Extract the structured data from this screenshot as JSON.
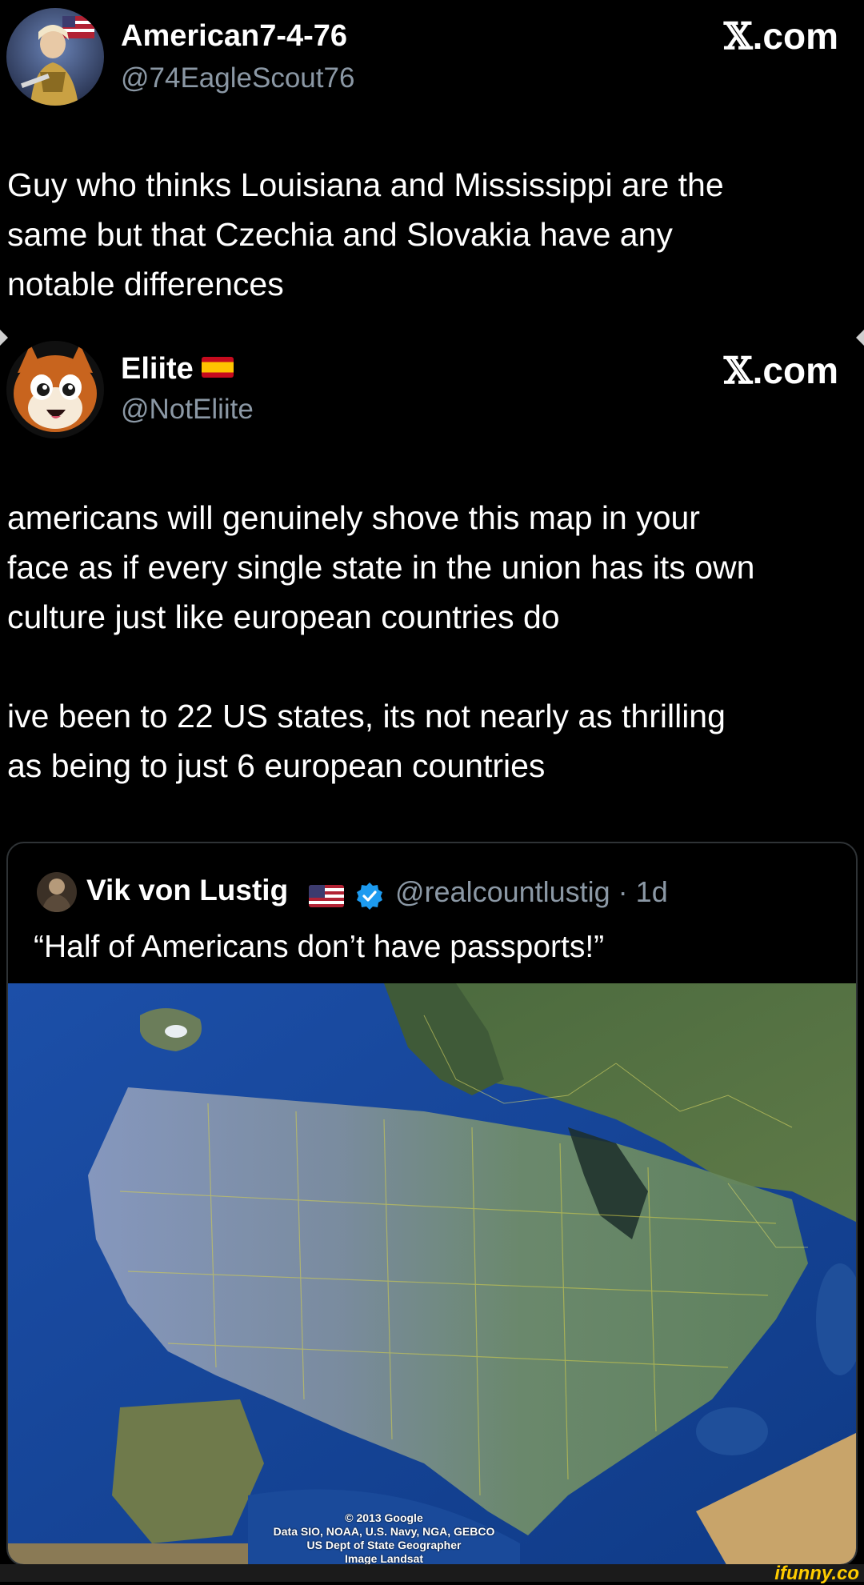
{
  "tweet1": {
    "display_name": "American7-4-76",
    "handle": "@74EagleScout76",
    "brand": ".com",
    "text": "Guy who thinks Louisiana and Mississippi are the\nsame but that Czechia and Slovakia have any\nnotable differences"
  },
  "tweet2": {
    "display_name": "Eliite",
    "handle": "@NotEliite",
    "brand": ".com",
    "text": "americans will genuinely shove this map in your\nface as if every single state in the union has its own\nculture just like european countries do\n\nive been to 22 US states, its not nearly as thrilling\nas being to just 6 european countries",
    "quote": {
      "display_name": "Vik von Lustig",
      "handle_time": "@realcountlustig · 1d",
      "text": "“Half of Americans don’t have passports!”",
      "map_attribution": [
        "© 2013 Google",
        "Data SIO, NOAA, U.S. Navy, NGA, GEBCO",
        "US Dept of State Geographer",
        "Image Landsat"
      ]
    }
  },
  "watermark": "ifunny.co",
  "colors": {
    "background": "#000000",
    "text": "#ffffff",
    "secondary_text": "#8b98a5",
    "verified": "#1d9bf0",
    "border": "#2f3336",
    "ifunny": "#ffcc00"
  },
  "icons": [
    "x-logo-icon",
    "spain-flag-icon",
    "usa-flag-icon",
    "verified-badge-icon"
  ]
}
